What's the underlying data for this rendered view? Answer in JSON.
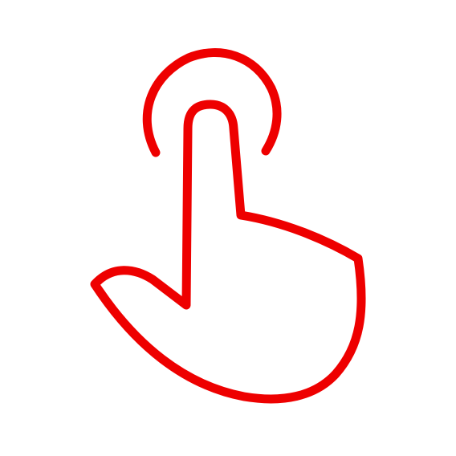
{
  "icon": {
    "name": "tap-gesture-icon",
    "color": "#ee0000",
    "background": "#ffffff"
  }
}
